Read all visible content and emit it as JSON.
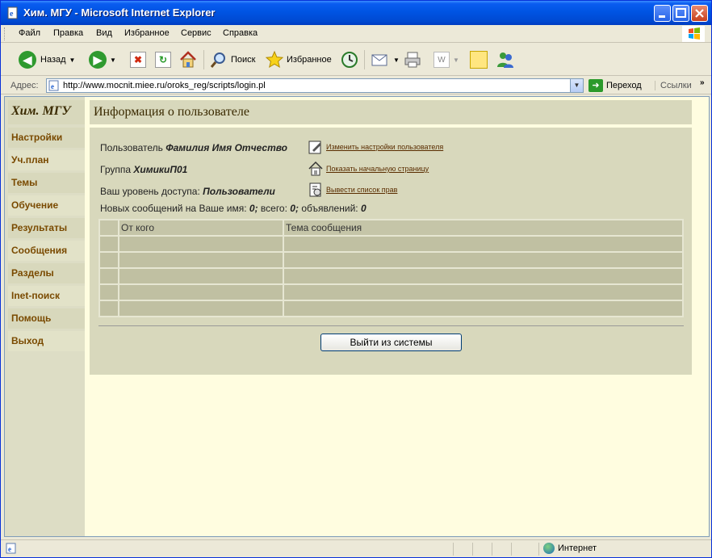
{
  "window": {
    "title": "Хим. МГУ - Microsoft Internet Explorer"
  },
  "menu": {
    "items": [
      "Файл",
      "Правка",
      "Вид",
      "Избранное",
      "Сервис",
      "Справка"
    ]
  },
  "toolbar": {
    "back_label": "Назад",
    "search_label": "Поиск",
    "favorites_label": "Избранное"
  },
  "address": {
    "label": "Адрес:",
    "url": "http://www.mocnit.miee.ru/oroks_reg/scripts/login.pl",
    "go_label": "Переход",
    "links_label": "Ссылки"
  },
  "sidebar": {
    "brand": "Хим. МГУ",
    "items": [
      "Настройки",
      "Уч.план",
      "Темы",
      "Обучение",
      "Результаты",
      "Сообщения",
      "Разделы",
      "Inet-поиск",
      "Помощь",
      "Выход"
    ]
  },
  "main": {
    "heading": "Информация о пользователе",
    "user_label": "Пользователь",
    "user_value": "Фамилия Имя Отчество",
    "group_label": "Группа",
    "group_value": "ХимикиП01",
    "access_label": "Ваш уровень доступа:",
    "access_value": "Пользователи",
    "messages_prefix": "Новых сообщений на Ваше имя:",
    "messages_new": "0;",
    "messages_total_label": "всего:",
    "messages_total": "0;",
    "messages_ads_label": "объявлений:",
    "messages_ads": "0",
    "actions": {
      "change_settings": "Изменить настройки пользователя",
      "show_home": "Показать начальную страницу",
      "list_rights": "Вывести список прав"
    },
    "table": {
      "col_from": "От кого",
      "col_subject": "Тема сообщения"
    },
    "logout_label": "Выйти из системы"
  },
  "status": {
    "zone": "Интернет"
  }
}
